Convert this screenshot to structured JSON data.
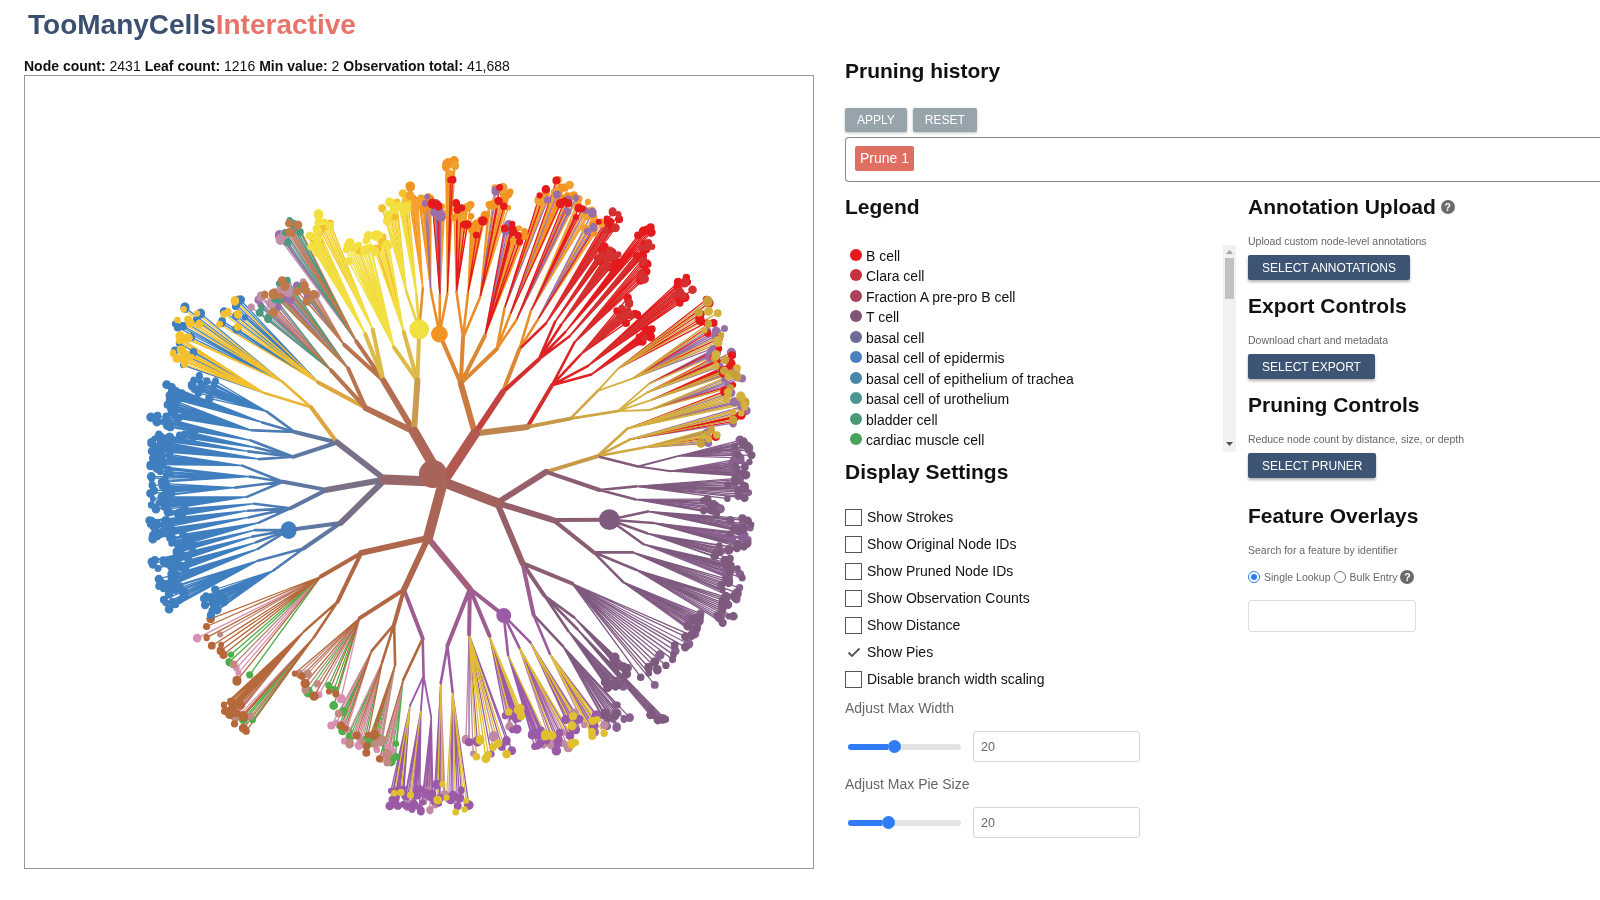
{
  "title": {
    "primary": "TooManyCells",
    "accent": "Interactive"
  },
  "stats": [
    {
      "label": "Node count:",
      "value": "2431"
    },
    {
      "label": "Leaf count:",
      "value": "1216"
    },
    {
      "label": "Min value:",
      "value": "2"
    },
    {
      "label": "Observation total:",
      "value": "41,688"
    }
  ],
  "pruning_history": {
    "title": "Pruning history",
    "buttons": [
      {
        "label": "APPLY",
        "disabled": true
      },
      {
        "label": "RESET",
        "disabled": true
      }
    ],
    "entries": [
      {
        "label": "Prune 1"
      }
    ]
  },
  "legend": {
    "title": "Legend",
    "items": [
      {
        "label": "B cell",
        "color": "#e41a1c"
      },
      {
        "label": "Clara cell",
        "color": "#c7313f"
      },
      {
        "label": "Fraction A pre-pro B cell",
        "color": "#a9405c"
      },
      {
        "label": "T cell",
        "color": "#7f5578"
      },
      {
        "label": "basal cell",
        "color": "#6c6a98"
      },
      {
        "label": "basal cell of epidermis",
        "color": "#4a7fc0"
      },
      {
        "label": "basal cell of epithelium of trachea",
        "color": "#4a86a8"
      },
      {
        "label": "basal cell of urothelium",
        "color": "#4a9690"
      },
      {
        "label": "bladder cell",
        "color": "#4a9a78"
      },
      {
        "label": "cardiac muscle cell",
        "color": "#4aa35c"
      }
    ]
  },
  "display_settings": {
    "title": "Display Settings",
    "options": [
      {
        "label": "Show Strokes",
        "checked": false
      },
      {
        "label": "Show Original Node IDs",
        "checked": false
      },
      {
        "label": "Show Pruned Node IDs",
        "checked": false
      },
      {
        "label": "Show Observation Counts",
        "checked": false
      },
      {
        "label": "Show Distance",
        "checked": false
      },
      {
        "label": "Show Pies",
        "checked": true
      },
      {
        "label": "Disable branch width scaling",
        "checked": false
      }
    ],
    "sliders": [
      {
        "label": "Adjust Max Width",
        "level": 0.41,
        "value": "20"
      },
      {
        "label": "Adjust Max Pie Size",
        "level": 0.35,
        "value": "20"
      }
    ]
  },
  "annotation_upload": {
    "title": "Annotation Upload",
    "help": "?",
    "description": "Upload custom node-level annotations",
    "button": "SELECT ANNOTATIONS"
  },
  "export_controls": {
    "title": "Export Controls",
    "description": "Download chart and metadata",
    "button": "SELECT EXPORT"
  },
  "pruning_controls": {
    "title": "Pruning Controls",
    "description": "Reduce node count by distance, size, or depth",
    "button": "SELECT PRUNER"
  },
  "feature_overlays": {
    "title": "Feature Overlays",
    "description": "Search for a feature by identifier",
    "modes": [
      {
        "label": "Single Lookup",
        "selected": true
      },
      {
        "label": "Bulk Entry",
        "selected": false
      }
    ],
    "help": "?"
  }
}
